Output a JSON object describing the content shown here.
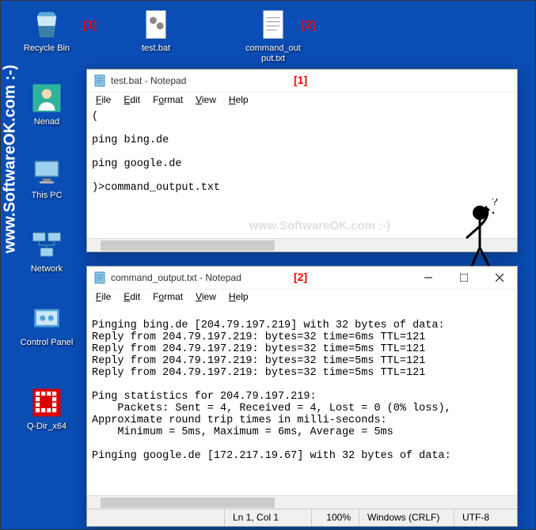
{
  "desktop": {
    "icons": [
      {
        "label": "Recycle Bin"
      },
      {
        "label": "test.bat"
      },
      {
        "label": "command_output.txt"
      },
      {
        "label": "Nenad"
      },
      {
        "label": "This PC"
      },
      {
        "label": "Network"
      },
      {
        "label": "Control Panel"
      },
      {
        "label": "Q-Dir_x64"
      }
    ]
  },
  "annotations": {
    "a1": "[1]",
    "a2": "[2]"
  },
  "watermark": {
    "vertical": "www.SoftwareOK.com :-)",
    "center": "www.SoftwareOK.com :-)"
  },
  "window1": {
    "title": "test.bat - Notepad",
    "menus": [
      "File",
      "Edit",
      "Format",
      "View",
      "Help"
    ],
    "content": "(\n\nping bing.de\n\nping google.de\n\n)>command_output.txt"
  },
  "window2": {
    "title": "command_output.txt - Notepad",
    "menus": [
      "File",
      "Edit",
      "Format",
      "View",
      "Help"
    ],
    "content": "\nPinging bing.de [204.79.197.219] with 32 bytes of data:\nReply from 204.79.197.219: bytes=32 time=6ms TTL=121\nReply from 204.79.197.219: bytes=32 time=5ms TTL=121\nReply from 204.79.197.219: bytes=32 time=5ms TTL=121\nReply from 204.79.197.219: bytes=32 time=5ms TTL=121\n\nPing statistics for 204.79.197.219:\n    Packets: Sent = 4, Received = 4, Lost = 0 (0% loss),\nApproximate round trip times in milli-seconds:\n    Minimum = 5ms, Maximum = 6ms, Average = 5ms\n\nPinging google.de [172.217.19.67] with 32 bytes of data:",
    "status": {
      "pos": "Ln 1, Col 1",
      "zoom": "100%",
      "eol": "Windows (CRLF)",
      "enc": "UTF-8"
    }
  }
}
